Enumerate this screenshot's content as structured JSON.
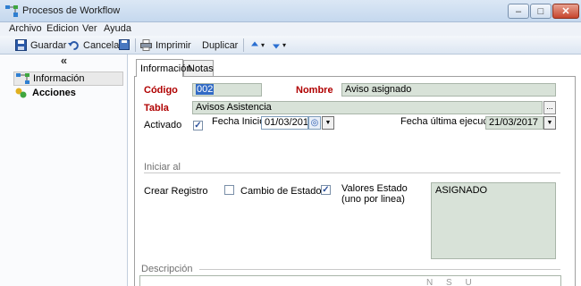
{
  "window": {
    "title": "Procesos de Workflow",
    "minimize_glyph": "–",
    "maximize_glyph": "□",
    "close_glyph": "✕"
  },
  "menu": {
    "items": [
      {
        "label": "Archivo"
      },
      {
        "label": "Edicion"
      },
      {
        "label": "Ver"
      },
      {
        "label": "Ayuda"
      }
    ]
  },
  "toolbar": {
    "save_label": "Guardar",
    "cancel_label": "Cancelar",
    "print_label": "Imprimir",
    "duplicate_label": "Duplicar",
    "nav_arrow": "▾"
  },
  "sidebar": {
    "collapse_glyph": "«",
    "items": [
      {
        "label": "Información",
        "selected": true
      },
      {
        "label": "Acciones",
        "selected": false
      }
    ]
  },
  "tabs": [
    {
      "label": "Información",
      "active": true
    },
    {
      "label": "Notas",
      "active": false
    }
  ],
  "form": {
    "codigo_label": "Código",
    "codigo_value": "002",
    "nombre_label": "Nombre",
    "nombre_value": "Aviso asignado",
    "tabla_label": "Tabla",
    "tabla_value": "Avisos Asistencia",
    "tabla_button": "...",
    "activado_label": "Activado",
    "activado_checked": true,
    "fecha_inicio_label": "Fecha Inicio",
    "fecha_inicio_value": "01/03/201",
    "fecha_ultima_label": "Fecha última ejecución",
    "fecha_ultima_value": "21/03/2017",
    "iniciar_al_label": "Iniciar al",
    "crear_registro_label": "Crear Registro",
    "crear_registro_checked": false,
    "cambio_estado_label": "Cambio de Estado",
    "cambio_estado_checked": true,
    "valores_estado_label_1": "Valores Estado",
    "valores_estado_label_2": "(uno por linea)",
    "valores_estado_value": "ASIGNADO",
    "descripcion_label": "Descripción",
    "editor_tools": "N S U"
  },
  "colors": {
    "required_label": "#b00000",
    "field_bg": "#d8e2d8",
    "selection": "#316ac5"
  }
}
